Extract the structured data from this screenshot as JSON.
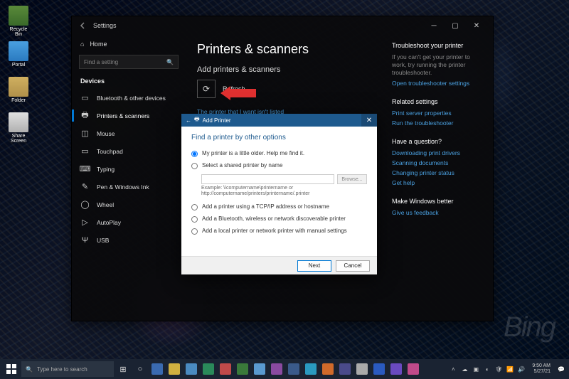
{
  "desktop": {
    "icons": [
      "Recycle Bin",
      "Portal",
      "Folder",
      "Share Screen"
    ],
    "bing": "Bing"
  },
  "settings": {
    "window_title": "Settings",
    "home": "Home",
    "search_placeholder": "Find a setting",
    "category": "Devices",
    "sidebar": [
      "Bluetooth & other devices",
      "Printers & scanners",
      "Mouse",
      "Touchpad",
      "Typing",
      "Pen & Windows Ink",
      "Wheel",
      "AutoPlay",
      "USB"
    ],
    "active_index": 1,
    "page_title": "Printers & scanners",
    "section_title": "Add printers & scanners",
    "refresh": "Refresh",
    "not_listed": "The printer that I want isn't listed"
  },
  "right": {
    "troubleshoot": {
      "h": "Troubleshoot your printer",
      "t": "If you can't get your printer to work, try running the printer troubleshooter.",
      "l": "Open troubleshooter settings"
    },
    "related": {
      "h": "Related settings",
      "links": [
        "Print server properties",
        "Run the troubleshooter"
      ]
    },
    "question": {
      "h": "Have a question?",
      "links": [
        "Downloading print drivers",
        "Scanning documents",
        "Changing printer status",
        "Get help"
      ]
    },
    "better": {
      "h": "Make Windows better",
      "links": [
        "Give us feedback"
      ]
    }
  },
  "dialog": {
    "title": "Add Printer",
    "heading": "Find a printer by other options",
    "options": [
      "My printer is a little older. Help me find it.",
      "Select a shared printer by name",
      "Add a printer using a TCP/IP address or hostname",
      "Add a Bluetooth, wireless or network discoverable printer",
      "Add a local printer or network printer with manual settings"
    ],
    "browse": "Browse...",
    "example": "Example: \\\\computername\\printername or http://computername/printers/printername/.printer",
    "next": "Next",
    "cancel": "Cancel"
  },
  "taskbar": {
    "search": "Type here to search",
    "time": "9:50 AM",
    "date": "5/27/21"
  }
}
